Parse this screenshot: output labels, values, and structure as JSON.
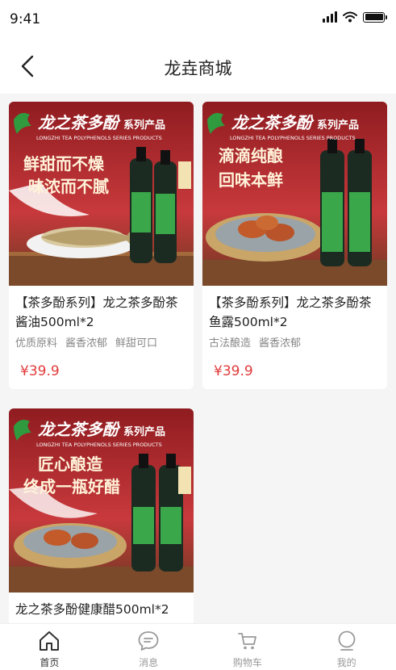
{
  "status": {
    "time": "9:41"
  },
  "nav": {
    "title": "龙垚商城"
  },
  "products": [
    {
      "banner_brand": "龙之茶多酚",
      "banner_series": "系列产品",
      "banner_en": "LONGZHI TEA POLYPHENOLS SERIES PRODUCTS",
      "slogan_1": "鲜甜而不燥",
      "slogan_2": "味浓而不腻",
      "title": "【茶多酚系列】龙之茶多酚茶酱油500ml*2",
      "tags": [
        "优质原料",
        "酱香浓郁",
        "鲜甜可口"
      ],
      "price": "¥39.9"
    },
    {
      "banner_brand": "龙之茶多酚",
      "banner_series": "系列产品",
      "banner_en": "LONGZHI TEA POLYPHENOLS SERIES PRODUCTS",
      "slogan_1": "滴滴纯酿",
      "slogan_2": "回味本鲜",
      "title": "【茶多酚系列】龙之茶多酚茶鱼露500ml*2",
      "tags": [
        "古法酿造",
        "酱香浓郁"
      ],
      "price": "¥39.9"
    },
    {
      "banner_brand": "龙之茶多酚",
      "banner_series": "系列产品",
      "banner_en": "LONGZHI TEA POLYPHENOLS SERIES PRODUCTS",
      "slogan_1": "匠心酿造",
      "slogan_2": "终成一瓶好醋",
      "title": "龙之茶多酚健康醋500ml*2",
      "tags": [],
      "price": ""
    }
  ],
  "tabs": [
    {
      "label": "首页",
      "icon": "home-icon",
      "active": true
    },
    {
      "label": "消息",
      "icon": "message-icon",
      "active": false
    },
    {
      "label": "购物车",
      "icon": "cart-icon",
      "active": false
    },
    {
      "label": "我的",
      "icon": "profile-icon",
      "active": false
    }
  ],
  "colors": {
    "price": "#e23b3b",
    "banner_red": "#b3262c",
    "bottle_label": "#3aa84a"
  }
}
